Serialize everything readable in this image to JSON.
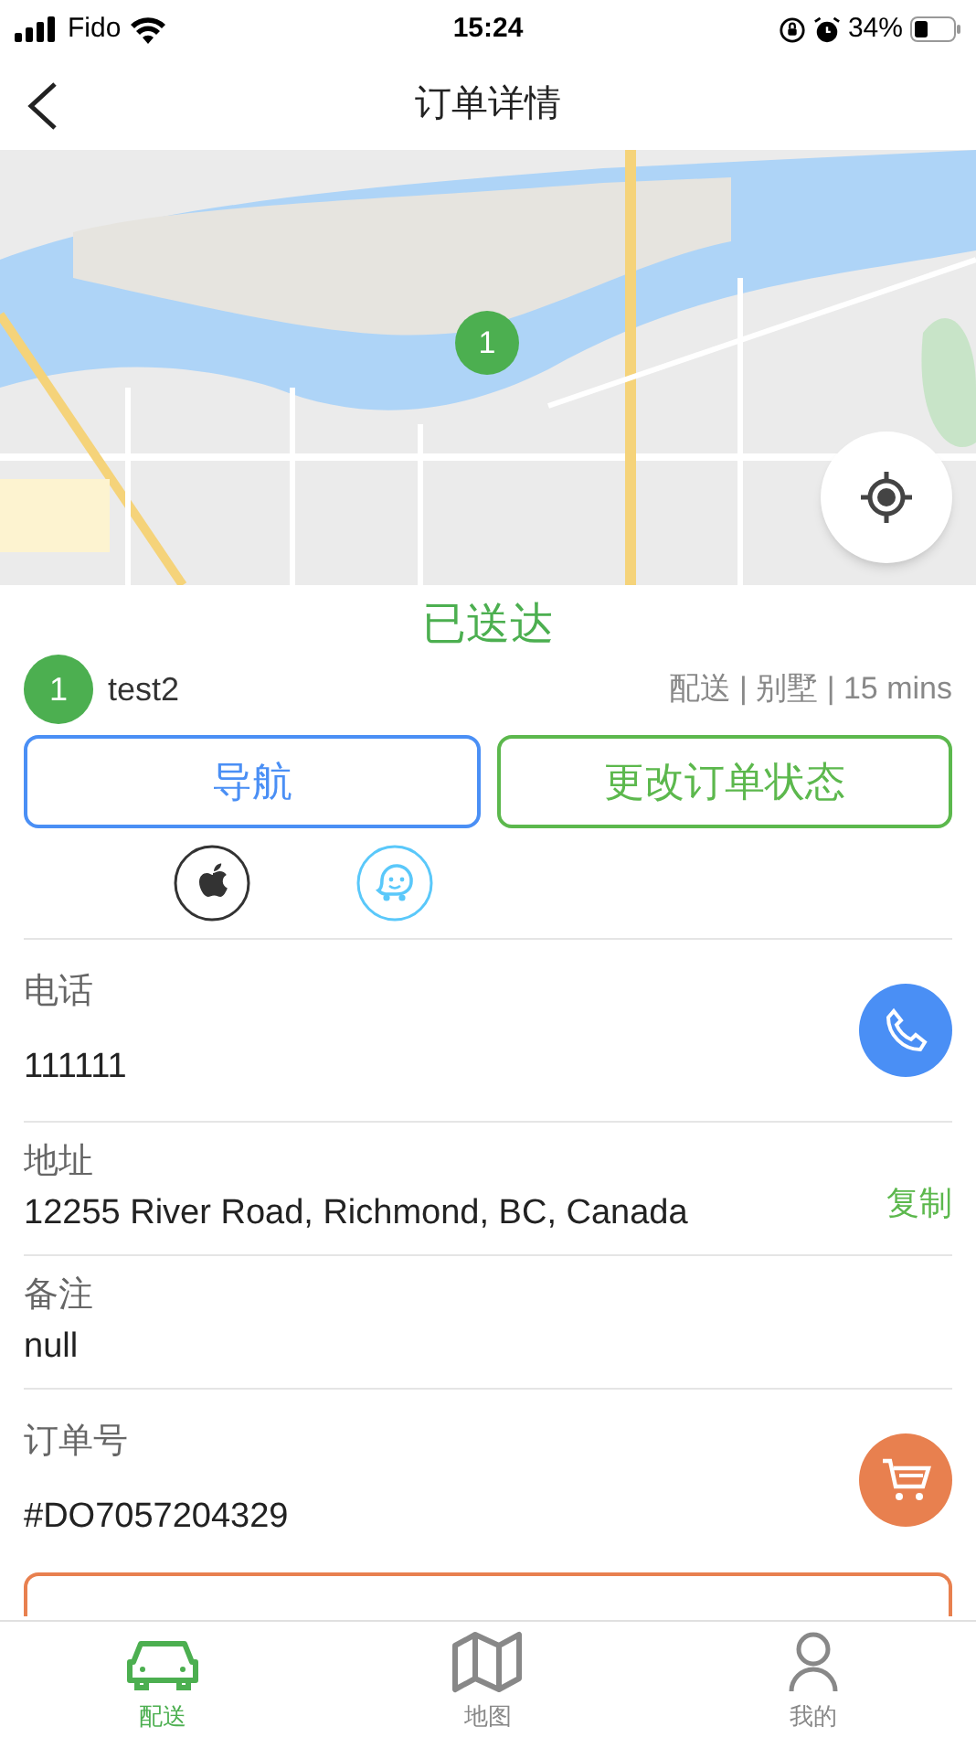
{
  "status_bar": {
    "carrier": "Fido",
    "time": "15:24",
    "battery": "34%"
  },
  "header": {
    "title": "订单详情"
  },
  "map": {
    "kind": "picture",
    "marker": "1"
  },
  "order": {
    "status": "已送达",
    "index": "1",
    "customer": "test2",
    "meta": "配送 | 别墅 | 15 mins"
  },
  "actions": [
    {
      "label": "导航",
      "kind": "navigate"
    },
    {
      "label": "更改订单状态",
      "kind": "status"
    }
  ],
  "nav_apps": [
    {
      "kind": "apple"
    },
    {
      "kind": "waze"
    }
  ],
  "fields": [
    {
      "label": "电话",
      "value": "111111",
      "action": {
        "kind": "phone"
      }
    },
    {
      "label": "地址",
      "value": "12255 River Road, Richmond, BC, Canada",
      "action": {
        "kind": "copy",
        "label": "复制"
      }
    },
    {
      "label": "备注",
      "value": "null"
    },
    {
      "label": "订单号",
      "value": "#DO7057204329",
      "action": {
        "kind": "cart"
      }
    }
  ],
  "tabs": [
    {
      "label": "配送",
      "kind": "car",
      "selected": true
    },
    {
      "label": "地图",
      "kind": "map",
      "selected": false
    },
    {
      "label": "我的",
      "kind": "person",
      "selected": false
    }
  ]
}
